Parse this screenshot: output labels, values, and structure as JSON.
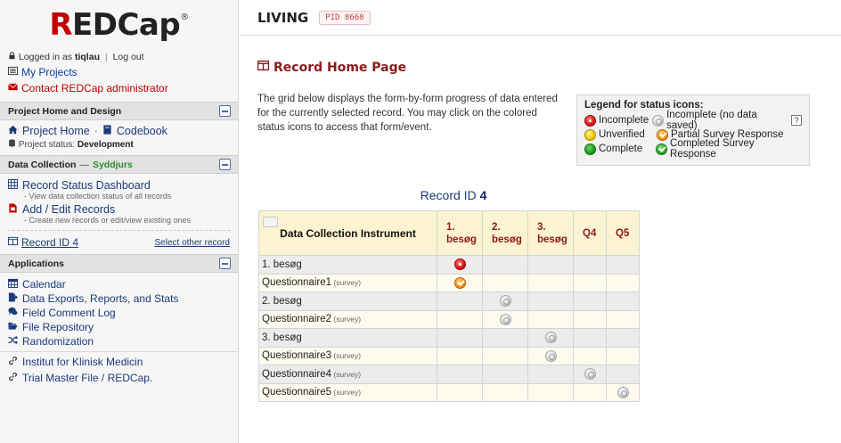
{
  "sidebar": {
    "logo_prefix": "R",
    "logo_rest": "EDCap",
    "logo_mark": "®",
    "logged_in_prefix": "Logged in as",
    "username": "tiqlau",
    "separator": "|",
    "logout": "Log out",
    "my_projects": "My Projects",
    "contact_admin": "Contact REDCap administrator",
    "sections": {
      "project_home": {
        "title": "Project Home and Design",
        "project_home": "Project Home",
        "dot_sep": "·",
        "codebook": "Codebook",
        "status_label": "Project status:",
        "status_value": "Development"
      },
      "data_collection": {
        "title": "Data Collection",
        "dash": "—",
        "dag": "Syddjurs",
        "record_status_dashboard": "Record Status Dashboard",
        "record_status_desc": "- View data collection status of all records",
        "add_edit_records": "Add / Edit Records",
        "add_edit_desc": "- Create new records or edit/view existing ones",
        "record_id": "Record ID 4",
        "select_other": "Select other record"
      },
      "applications": {
        "title": "Applications",
        "items": [
          "Calendar",
          "Data Exports, Reports, and Stats",
          "Field Comment Log",
          "File Repository",
          "Randomization"
        ]
      }
    },
    "bookmarks": [
      "Institut for Klinisk Medicin",
      "Trial Master File / REDCap."
    ]
  },
  "header": {
    "project_title": "LIVING",
    "pid": "PID 8668"
  },
  "main": {
    "page_title": "Record Home Page",
    "intro": "The grid below displays the form-by-form progress of data entered for the currently selected record. You may click on the colored status icons to access that form/event.",
    "legend": {
      "title": "Legend for status icons:",
      "incomplete": "Incomplete",
      "incomplete_nodata": "Incomplete (no data saved)",
      "help": "?",
      "unverified": "Unverified",
      "partial_survey": "Partial Survey Response",
      "complete": "Complete",
      "completed_survey": "Completed Survey Response"
    },
    "record_caption_prefix": "Record ID",
    "record_caption_id": "4",
    "grid": {
      "instrument_header": "Data Collection Instrument",
      "events": [
        "1. besøg",
        "2. besøg",
        "3. besøg",
        "Q4",
        "Q5"
      ],
      "survey_tag": "(survey)",
      "rows": [
        {
          "name": "1. besøg",
          "survey": false,
          "statuses": [
            "incomplete",
            "",
            "",
            "",
            ""
          ]
        },
        {
          "name": "Questionnaire1",
          "survey": true,
          "statuses": [
            "partial_survey",
            "",
            "",
            "",
            ""
          ]
        },
        {
          "name": "2. besøg",
          "survey": false,
          "statuses": [
            "",
            "no_data",
            "",
            "",
            ""
          ]
        },
        {
          "name": "Questionnaire2",
          "survey": true,
          "statuses": [
            "",
            "no_data",
            "",
            "",
            ""
          ]
        },
        {
          "name": "3. besøg",
          "survey": false,
          "statuses": [
            "",
            "",
            "no_data",
            "",
            ""
          ]
        },
        {
          "name": "Questionnaire3",
          "survey": true,
          "statuses": [
            "",
            "",
            "no_data",
            "",
            ""
          ]
        },
        {
          "name": "Questionnaire4",
          "survey": true,
          "statuses": [
            "",
            "",
            "",
            "no_data",
            ""
          ]
        },
        {
          "name": "Questionnaire5",
          "survey": true,
          "statuses": [
            "",
            "",
            "",
            "",
            "no_data"
          ]
        }
      ]
    }
  },
  "colors": {
    "brand_red": "#c00000",
    "link_blue": "#1a3a7a",
    "page_title": "#8b1a1a",
    "header_yellow": "#fcf4d0",
    "dag_green": "#2e8b2e"
  }
}
